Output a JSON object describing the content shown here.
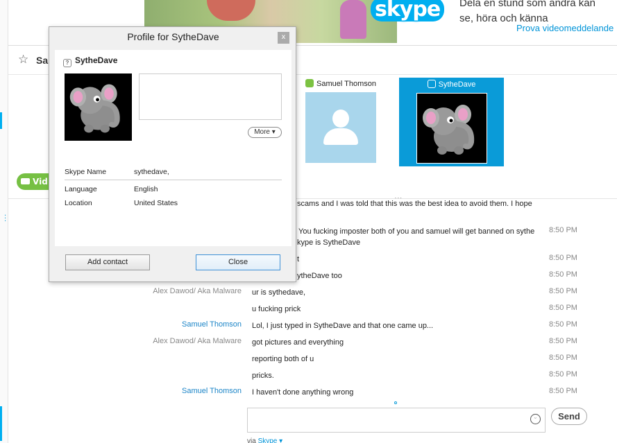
{
  "banner": {
    "logo_text": "skype",
    "promo_line1": "Dela en stund som andra kan",
    "promo_line2": "se, höra och känna",
    "promo_link": "Prova videomeddelande"
  },
  "conversation": {
    "title": "Sar",
    "video_button_label": "Vid",
    "participants": [
      {
        "name": "Samuel Thomson",
        "status": "online"
      },
      {
        "name": "SytheDave",
        "status": "unknown"
      }
    ],
    "more_dots": "...",
    "messages": [
      {
        "sender": "",
        "sender_type": "",
        "text": "scams and I was told that this was the best idea to avoid them. I hope",
        "time": ""
      },
      {
        "sender": "",
        "sender_type": "",
        "text": "You fucking imposter both of you and samuel will get banned on sythe",
        "text2": "kype is SytheDave",
        "time": "8:50 PM"
      },
      {
        "sender": "",
        "sender_type": "",
        "text": "t",
        "time": "8:50 PM"
      },
      {
        "sender": "",
        "sender_type": "",
        "text": "ytheDave too",
        "time": "8:50 PM"
      },
      {
        "sender": "Alex Dawod/ Aka Malware",
        "sender_type": "alex",
        "text": "ur is sythedave,",
        "time": "8:50 PM"
      },
      {
        "sender": "",
        "sender_type": "",
        "text": "u fucking prick",
        "time": "8:50 PM"
      },
      {
        "sender": "Samuel Thomson",
        "sender_type": "samuel",
        "text": "Lol, I just typed in SytheDave and that one came up...",
        "time": "8:50 PM"
      },
      {
        "sender": "Alex Dawod/ Aka Malware",
        "sender_type": "alex",
        "text": "got pictures and everything",
        "time": "8:50 PM"
      },
      {
        "sender": "",
        "sender_type": "",
        "text": "reporting both of u",
        "time": "8:50 PM"
      },
      {
        "sender": "",
        "sender_type": "",
        "text": "pricks.",
        "time": "8:50 PM"
      },
      {
        "sender": "Samuel Thomson",
        "sender_type": "samuel",
        "text": "I haven't done anything wrong",
        "time": "8:50 PM"
      }
    ],
    "input_placeholder": "",
    "send_label": "Send",
    "via_prefix": "via",
    "via_link": "Skype"
  },
  "profile_dialog": {
    "title": "Profile for SytheDave",
    "close_label": "x",
    "display_name": "SytheDave",
    "more_label": "More",
    "fields": [
      {
        "label": "Skype Name",
        "value": "sythedave,"
      },
      {
        "label": "Language",
        "value": "English"
      },
      {
        "label": "Location",
        "value": "United States"
      }
    ],
    "add_contact_label": "Add contact",
    "close_button_label": "Close"
  },
  "colors": {
    "accent": "#00aff0",
    "link": "#1a84c7",
    "online": "#7cc242"
  }
}
